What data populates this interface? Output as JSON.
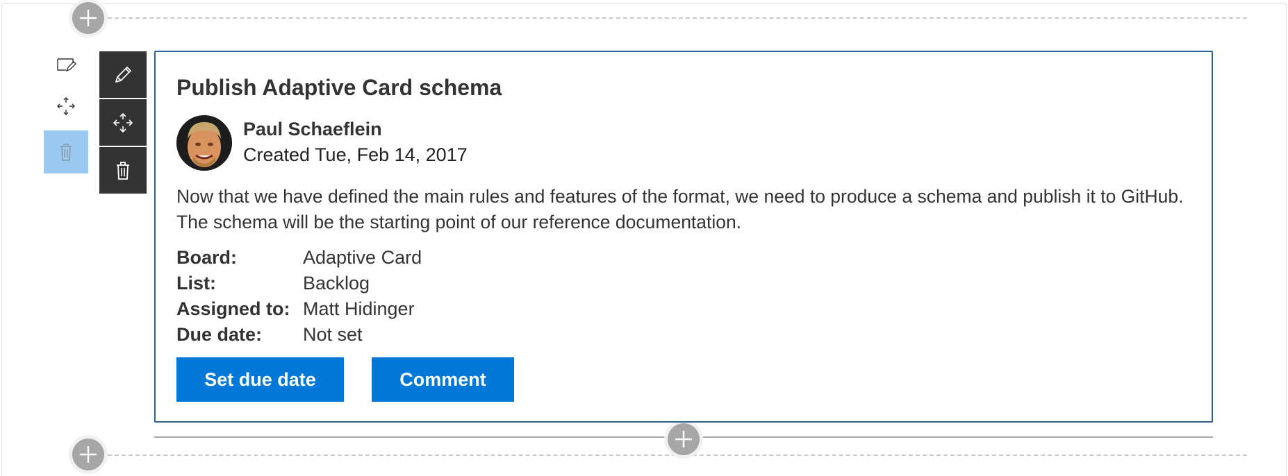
{
  "card": {
    "title": "Publish Adaptive Card schema",
    "author": "Paul Schaeflein",
    "created": "Created Tue, Feb 14, 2017",
    "description": "Now that we have defined the main rules and features of the format, we need to produce a schema and publish it to GitHub. The schema will be the starting point of our reference documentation.",
    "facts": [
      {
        "title": "Board:",
        "value": "Adaptive Card"
      },
      {
        "title": "List:",
        "value": "Backlog"
      },
      {
        "title": "Assigned to:",
        "value": "Matt Hidinger"
      },
      {
        "title": "Due date:",
        "value": "Not set"
      }
    ],
    "actions": [
      {
        "label": "Set due date"
      },
      {
        "label": "Comment"
      }
    ]
  },
  "toolbar": {
    "edit_icon": "pencil-icon",
    "move_icon": "move-icon",
    "delete_icon": "trash-icon"
  },
  "ghost_toolbar": {
    "edit_icon": "edit-note-icon",
    "move_icon": "move-icon",
    "delete_icon": "trash-icon"
  },
  "colors": {
    "accent": "#0078d7",
    "card_border": "#2d5f9a",
    "toolbar_bg": "#333333",
    "ghost_delete_bg": "#99c9f0",
    "plus_bg": "#a6a6a6"
  }
}
